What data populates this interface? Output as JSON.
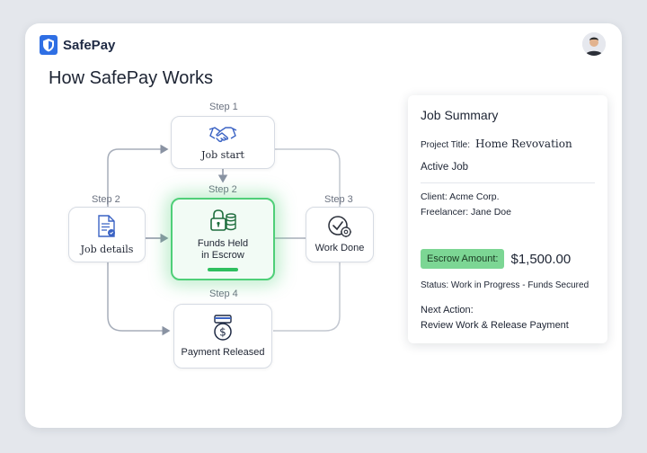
{
  "app": {
    "name": "SafePay"
  },
  "page": {
    "title": "How SafePay Works"
  },
  "steps": {
    "job_start": {
      "step": "Step 1",
      "label": "Job start"
    },
    "job_details": {
      "step": "Step 2",
      "label": "Job details"
    },
    "funds_held": {
      "step": "Step 2",
      "label_line1": "Funds Held",
      "label_line2": "in Escrow"
    },
    "work_done": {
      "step": "Step 3",
      "label": "Work Done"
    },
    "payment_released": {
      "step": "Step 4",
      "label": "Payment Released"
    }
  },
  "summary": {
    "title": "Job Summary",
    "project_title_label": "Project Title:",
    "project_title_value": "Home Revovation",
    "active_job": "Active Job",
    "client_label": "Client:",
    "client_value": "Acme Corp.",
    "freelancer_label": "Freelancer:",
    "freelancer_value": "Jane Doe",
    "escrow_label": "Escrow Amount:",
    "escrow_value": "$1,500.00",
    "status_label": "Status:",
    "status_value": "Work in Progress - Funds Secured",
    "next_action_label": "Next Action:",
    "next_action_value": "Review Work & Release Payment"
  },
  "colors": {
    "accent": "#2f6fe4",
    "success": "#2fbf5f",
    "badge": "#7cd694"
  },
  "icons": {
    "logo": "shield-icon",
    "job_start": "handshake-icon",
    "job_details": "document-icon",
    "funds_held": "lock-coins-icon",
    "work_done": "check-gear-icon",
    "payment_released": "dollar-coin-icon"
  }
}
